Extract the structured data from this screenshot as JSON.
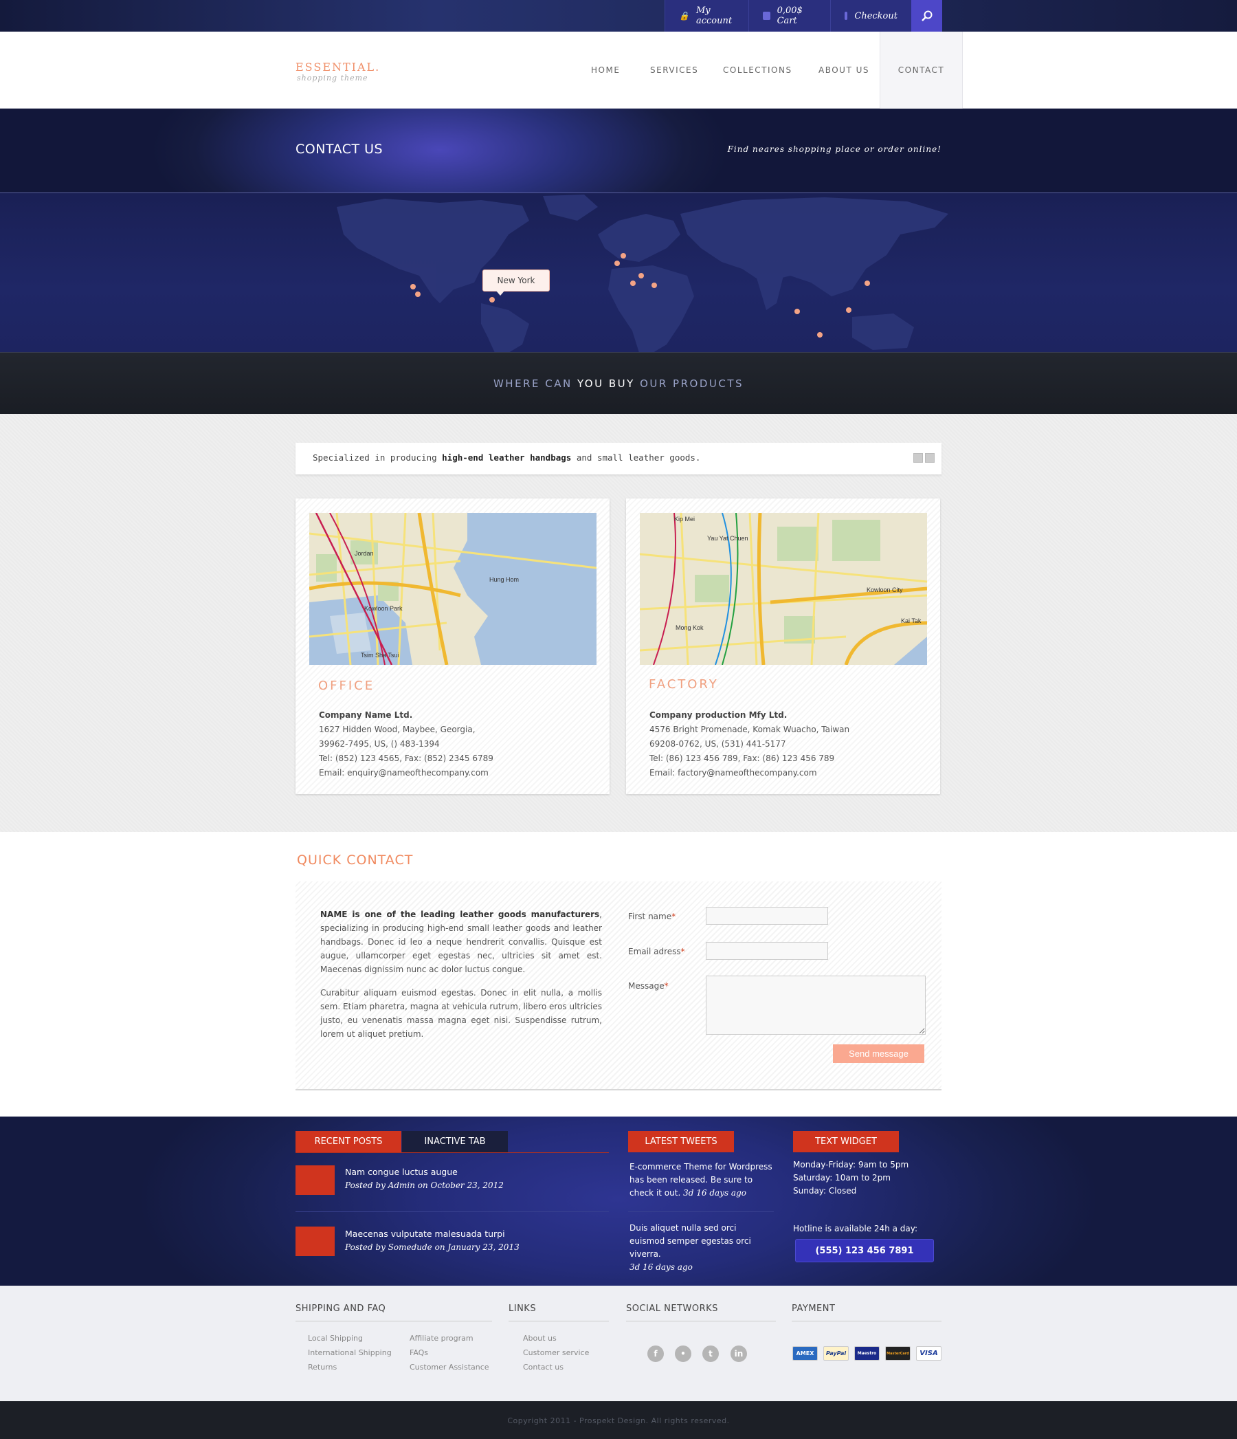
{
  "topbar": {
    "account": "My account",
    "cart": "0,00$ Cart",
    "checkout": "Checkout"
  },
  "header": {
    "logo": "ESSENTIAL.",
    "logo_sub": "shopping theme",
    "nav": [
      "HOME",
      "SERVICES",
      "COLLECTIONS",
      "ABOUT US",
      "CONTACT"
    ],
    "active": "CONTACT"
  },
  "titleband": {
    "title": "CONTACT US",
    "tagline": "Find neares shopping place or order online!"
  },
  "map": {
    "tooltip": "New York",
    "where_pre": "WHERE CAN",
    "where_bold": "YOU BUY",
    "where_post": "OUR PRODUCTS"
  },
  "intro": {
    "pre": "Specialized in producing",
    "bold": "high-end leather handbags",
    "post": "and small leather goods."
  },
  "office": {
    "title": "OFFICE",
    "company": "Company Name Ltd.",
    "line1": "1627 Hidden Wood, Maybee, Georgia,",
    "line2": "39962-7495, US, () 483-1394",
    "tel": "Tel: (852) 123 4565, Fax: (852) 2345 6789",
    "email": "Email: enquiry@nameofthecompany.com",
    "map_labels": [
      "Jordan",
      "Kowloon Park",
      "Tsim Sha Tsui",
      "Hung Hom"
    ]
  },
  "factory": {
    "title": "FACTORY",
    "company": "Company production  Mfy Ltd.",
    "line1": "4576 Bright Promenade, Komak Wuacho, Taiwan",
    "line2": "69208-0762, US, (531) 441-5177",
    "tel": "Tel: (86) 123 456 789, Fax: (86) 123 456 789",
    "email": "Email: factory@nameofthecompany.com",
    "map_labels": [
      "Kip Mei",
      "Yau Yat Chuen",
      "Kowloon City",
      "Mong Kok",
      "Kai Tak"
    ]
  },
  "quick": {
    "title": "QUICK CONTACT",
    "p1_bold": "NAME is one of the leading leather goods manufacturers",
    "p1_rest": ", specializing in producing high-end small leather goods and leather handbags. Donec id leo a neque hendrerit convallis. Quisque est augue, ullamcorper eget egestas nec, ultricies sit amet est. Maecenas dignissim nunc ac dolor luctus congue.",
    "p2": "Curabitur aliquam euismod egestas. Donec in elit nulla, a mollis sem. Etiam pharetra, magna at vehicula rutrum, libero eros ultricies justo, eu venenatis massa magna eget nisi. Suspendisse rutrum, lorem ut aliquet pretium.",
    "first_name": "First name",
    "email": "Email adress",
    "message": "Message",
    "required": "*",
    "send": "Send message"
  },
  "widgets": {
    "tab_recent": "RECENT POSTS",
    "tab_inactive": "INACTIVE TAB",
    "posts": [
      {
        "title": "Nam congue luctus augue",
        "meta": "Posted by Admin on October 23, 2012"
      },
      {
        "title": "Maecenas vulputate malesuada turpi",
        "meta": "Posted by Somedude on January 23, 2013"
      }
    ],
    "tweets_title": "LATEST TWEETS",
    "tweets": [
      {
        "text": "E-commerce Theme for Wordpress has been released. Be sure to check it out.",
        "age": "3d 16 days ago"
      },
      {
        "text": "Duis aliquet nulla sed orci euismod semper egestas orci viverra.",
        "age": "3d 16 days ago"
      }
    ],
    "text_title": "TEXT WIDGET",
    "hours": [
      "Monday-Friday: 9am to 5pm",
      "Saturday: 10am to 2pm",
      "Sunday: Closed"
    ],
    "hotline_label": "Hotline is available 24h a day:",
    "hotline": "(555) 123 456 7891"
  },
  "footer": {
    "shipping_title": "SHIPPING AND FAQ",
    "shipping_col1": [
      "Local Shipping",
      "International Shipping",
      "Returns"
    ],
    "shipping_col2": [
      "Affiliate program",
      "FAQs",
      "Customer Assistance"
    ],
    "links_title": "LINKS",
    "links": [
      "About us",
      "Customer service",
      "Contact us"
    ],
    "social_title": "SOCIAL NETWORKS",
    "payment_title": "PAYMENT",
    "payments": [
      "AMEX",
      "PayPal",
      "Maestro",
      "MasterCard",
      "VISA"
    ],
    "copyright": "Copyright 2011 - Prospekt Design. All rights reserved."
  },
  "colors": {
    "accent": "#f0906a",
    "widget_red": "#d0341e",
    "navy": "#1f2766",
    "button": "#faa890"
  }
}
